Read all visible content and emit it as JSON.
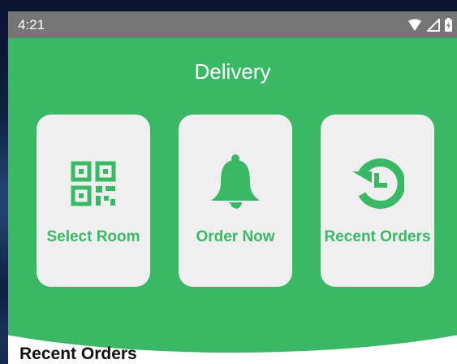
{
  "status_bar": {
    "time": "4:21",
    "icons": [
      "wifi-icon",
      "signal-icon",
      "battery-charging-icon"
    ]
  },
  "header": {
    "title": "Delivery"
  },
  "cards": [
    {
      "label": "Select Room",
      "icon": "qr-code-icon"
    },
    {
      "label": "Order Now",
      "icon": "bell-icon"
    },
    {
      "label": "Recent Orders",
      "icon": "history-icon"
    }
  ],
  "section": {
    "title": "Recent Orders"
  },
  "colors": {
    "brand_green": "#3bb866",
    "card_bg": "#efefef",
    "status_bar": "#757575"
  }
}
